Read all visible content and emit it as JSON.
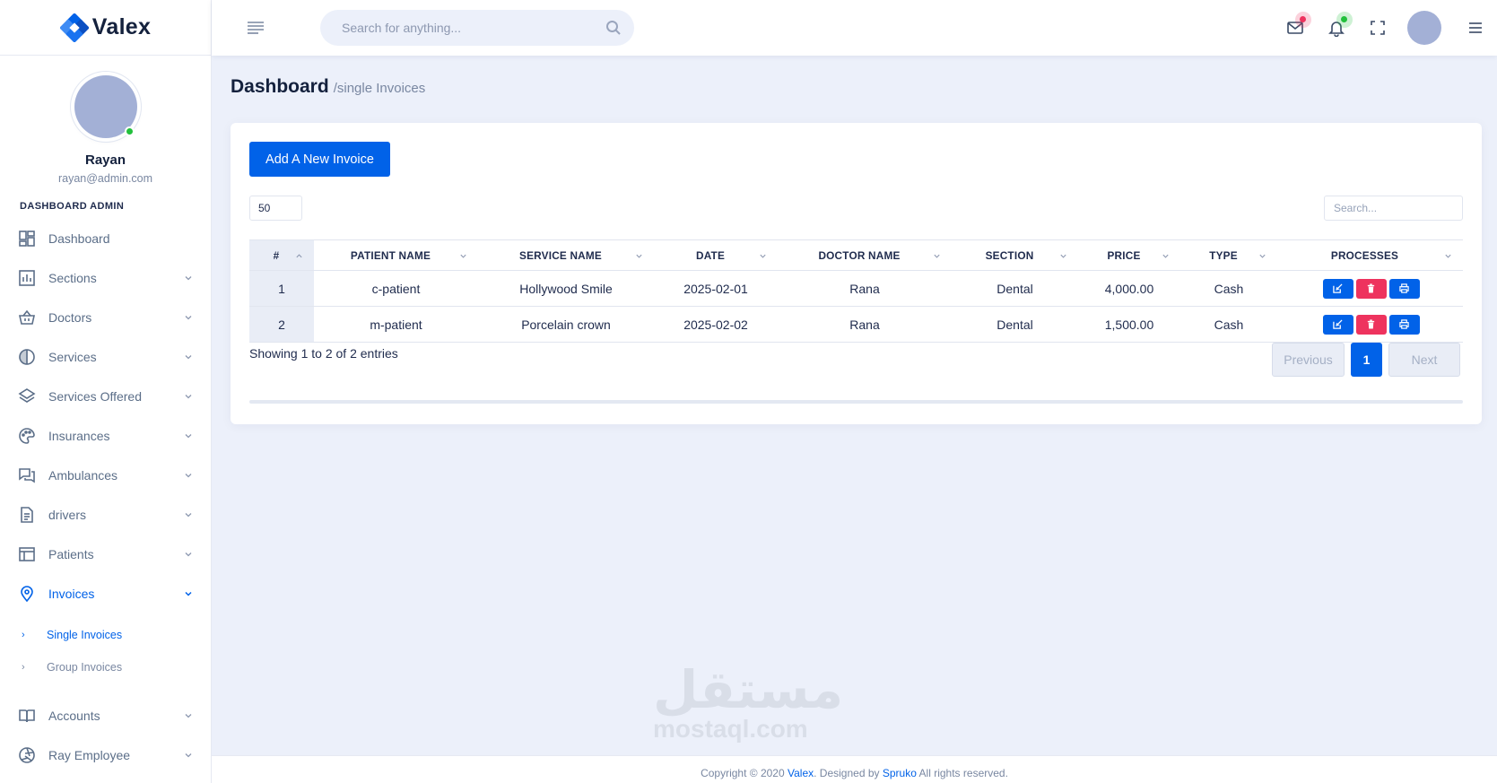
{
  "brand": {
    "name": "Valex",
    "colors": {
      "primary": "#0162e8",
      "danger": "#ee335e",
      "online": "#22c03c",
      "background": "#ecf0fa"
    }
  },
  "header": {
    "search_placeholder": "Search for anything...",
    "icons": [
      "hamburger-icon",
      "search-icon",
      "mail-icon",
      "bell-icon",
      "fullscreen-icon",
      "avatar",
      "menu-icon"
    ]
  },
  "profile": {
    "name": "Rayan",
    "email": "rayan@admin.com"
  },
  "sidebar": {
    "heading": "DASHBOARD ADMIN",
    "items": [
      {
        "label": "Dashboard",
        "icon": "dashboard-icon"
      },
      {
        "label": "Sections",
        "icon": "bar-chart-icon"
      },
      {
        "label": "Doctors",
        "icon": "basket-icon"
      },
      {
        "label": "Services",
        "icon": "pie-icon"
      },
      {
        "label": "Services Offered",
        "icon": "layers-icon"
      },
      {
        "label": "Insurances",
        "icon": "palette-icon"
      },
      {
        "label": "Ambulances",
        "icon": "chat-icon"
      },
      {
        "label": "drivers",
        "icon": "document-icon"
      },
      {
        "label": "Patients",
        "icon": "table-icon"
      },
      {
        "label": "Invoices",
        "icon": "map-pin-icon"
      }
    ],
    "invoices_sub": [
      {
        "label": "Single Invoices"
      },
      {
        "label": "Group Invoices"
      }
    ],
    "items_after": [
      {
        "label": "Accounts",
        "icon": "book-icon"
      },
      {
        "label": "Ray Employee",
        "icon": "aperture-icon"
      }
    ]
  },
  "page": {
    "title": "Dashboard",
    "subtitle": "/single Invoices"
  },
  "card": {
    "add_button": "Add A New Invoice",
    "page_length": "50",
    "search_placeholder": "Search...",
    "columns": [
      "#",
      "PATIENT NAME",
      "SERVICE NAME",
      "DATE",
      "DOCTOR NAME",
      "SECTION",
      "PRICE",
      "TYPE",
      "PROCESSES"
    ],
    "rows": [
      {
        "idx": "1",
        "patient": "c-patient",
        "service": "Hollywood Smile",
        "date": "2025-02-01",
        "doctor": "Rana",
        "section": "Dental",
        "price": "4,000.00",
        "type": "Cash"
      },
      {
        "idx": "2",
        "patient": "m-patient",
        "service": "Porcelain crown",
        "date": "2025-02-02",
        "doctor": "Rana",
        "section": "Dental",
        "price": "1,500.00",
        "type": "Cash"
      }
    ],
    "showing": "Showing 1 to 2 of 2 entries",
    "pagination": {
      "previous": "Previous",
      "current": "1",
      "next": "Next"
    }
  },
  "watermark": {
    "arabic": "مستقل",
    "latin": "mostaql.com"
  },
  "footer": {
    "prefix": "Copyright © 2020 ",
    "brand": "Valex",
    "middle": ". Designed by ",
    "designer": "Spruko",
    "suffix": " All rights reserved."
  }
}
